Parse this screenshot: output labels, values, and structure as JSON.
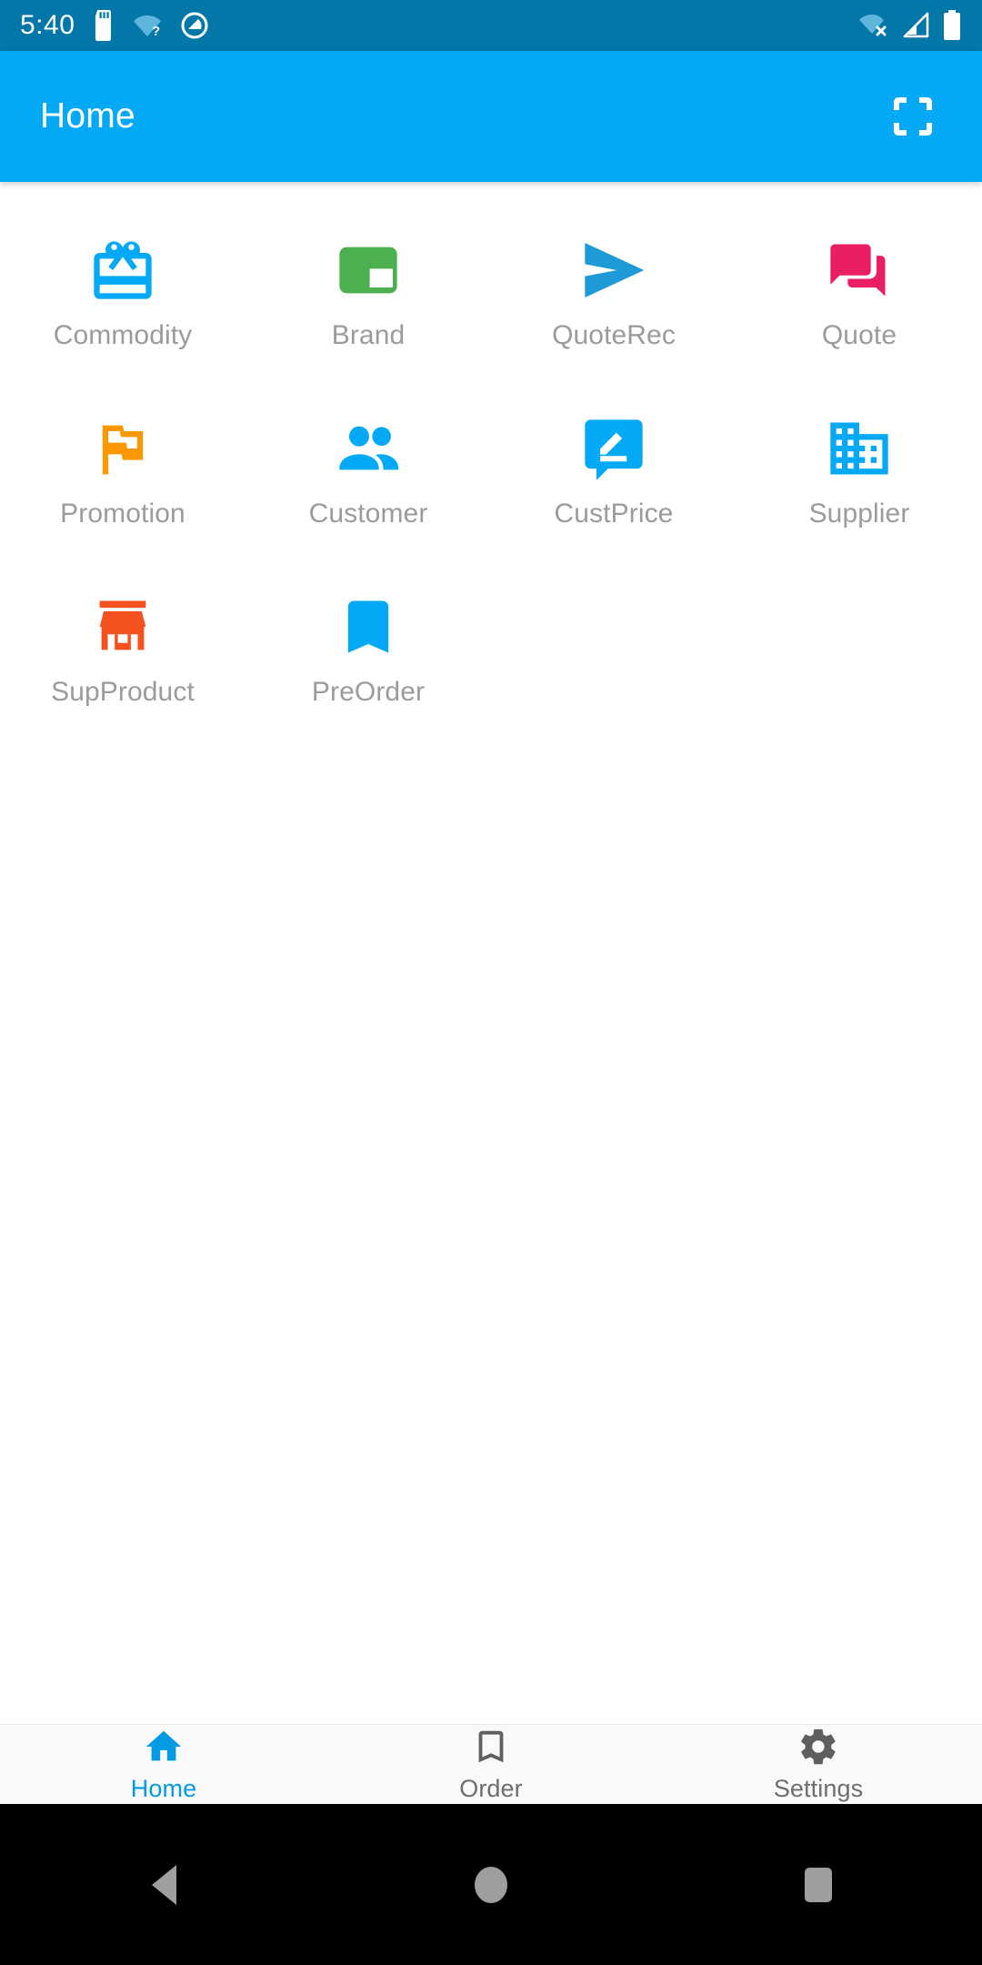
{
  "statusbar": {
    "time": "5:40",
    "background": "#0277a8",
    "left_icons": [
      "sd-card-icon",
      "wifi-question-icon",
      "do-not-disturb-icon"
    ],
    "right_icons": [
      "wifi-off-icon",
      "cell-signal-icon",
      "battery-full-icon"
    ]
  },
  "appbar": {
    "title": "Home",
    "background": "#03a9f4",
    "action_icon": "scan-fullscreen-icon"
  },
  "grid": {
    "items": [
      {
        "label": "Commodity",
        "icon": "gift-card-icon",
        "color": "#03a9f4"
      },
      {
        "label": "Brand",
        "icon": "picture-in-picture-icon",
        "color": "#4caf50"
      },
      {
        "label": "QuoteRec",
        "icon": "send-icon",
        "color": "#1e9bd7"
      },
      {
        "label": "Quote",
        "icon": "question-answer-icon",
        "color": "#e91e63"
      },
      {
        "label": "Promotion",
        "icon": "flag-outline-icon",
        "color": "#fb9800"
      },
      {
        "label": "Customer",
        "icon": "people-icon",
        "color": "#03a9f4"
      },
      {
        "label": "CustPrice",
        "icon": "rate-review-icon",
        "color": "#03a9f4"
      },
      {
        "label": "Supplier",
        "icon": "domain-building-icon",
        "color": "#03a9f4"
      },
      {
        "label": "SupProduct",
        "icon": "store-icon",
        "color": "#f4511e"
      },
      {
        "label": "PreOrder",
        "icon": "bookmark-icon",
        "color": "#03a9f4"
      }
    ],
    "label_color": "#9b9b9b"
  },
  "bottomnav": {
    "active_color": "#039be5",
    "inactive_color": "#6e6e6e",
    "items": [
      {
        "label": "Home",
        "icon": "home-icon",
        "active": true
      },
      {
        "label": "Order",
        "icon": "bookmark-outline-icon",
        "active": false
      },
      {
        "label": "Settings",
        "icon": "gear-icon",
        "active": false
      }
    ]
  },
  "navbar": {
    "buttons": [
      "back-triangle-icon",
      "home-circle-icon",
      "recents-square-icon"
    ]
  }
}
